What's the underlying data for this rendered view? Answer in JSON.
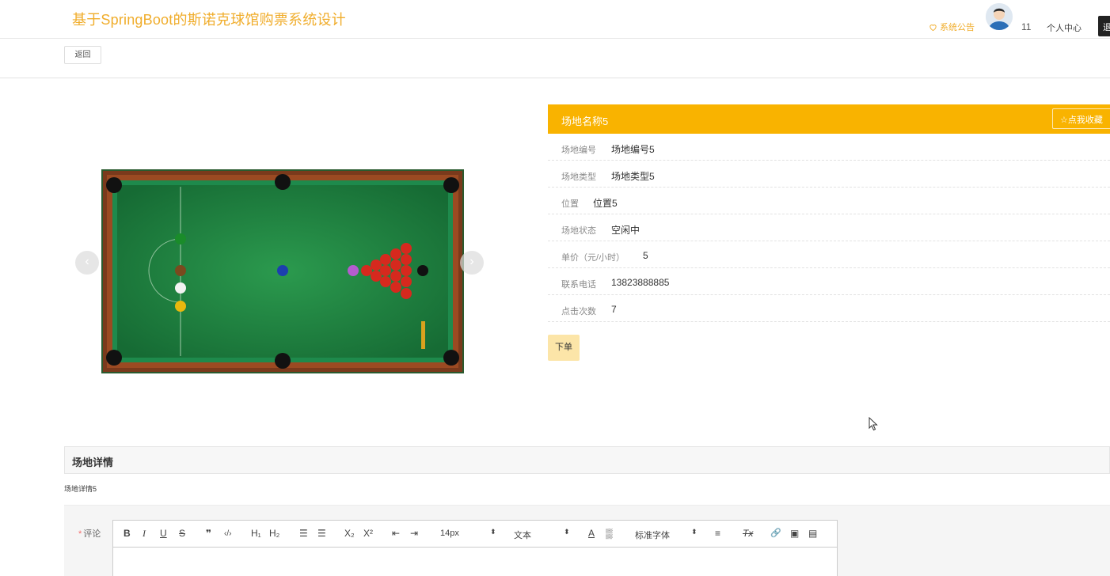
{
  "header": {
    "site_title": "基于SpringBoot的斯诺克球馆购票系统设计",
    "notice_label": "系统公告",
    "user_count": "11",
    "personal_center": "个人中心",
    "logout_label": "退"
  },
  "backbar": {
    "back_label": "返回"
  },
  "carousel": {
    "prev_arrow": "‹",
    "next_arrow": "›"
  },
  "panel": {
    "title": "场地名称5",
    "favorite_label": "☆点我收藏",
    "fields": [
      {
        "label": "场地编号",
        "value": "场地编号5"
      },
      {
        "label": "场地类型",
        "value": "场地类型5"
      },
      {
        "label": "位置",
        "value": "位置5"
      },
      {
        "label": "场地状态",
        "value": "空闲中"
      },
      {
        "label": "单价（元/小时）",
        "value": "5"
      },
      {
        "label": "联系电话",
        "value": "13823888885"
      },
      {
        "label": "点击次数",
        "value": "7"
      }
    ],
    "order_label": "下单"
  },
  "detail": {
    "heading": "场地详情",
    "content": "场地详情5"
  },
  "comment": {
    "required_mark": "*",
    "label": "评论",
    "toolbar": {
      "bold": "B",
      "italic": "I",
      "underline": "U",
      "strike": "S",
      "quote": "❞",
      "code": "‹/›",
      "h1": "H₁",
      "h2": "H₂",
      "ordered_list": "☰",
      "bullet_list": "☰",
      "subscript": "X₂",
      "superscript": "X²",
      "indent_left": "⇤",
      "indent_right": "⇥",
      "size_value": "14px",
      "header_value": "文本",
      "color": "A",
      "background": "▒",
      "font_value": "标准字体",
      "align": "≡",
      "clean": "Tx",
      "link": "🔗",
      "image": "▣",
      "video": "▤"
    }
  },
  "colors": {
    "accent": "#f9b300",
    "title_orange": "#f0ad2c",
    "order_button_bg": "#fce5a8"
  }
}
